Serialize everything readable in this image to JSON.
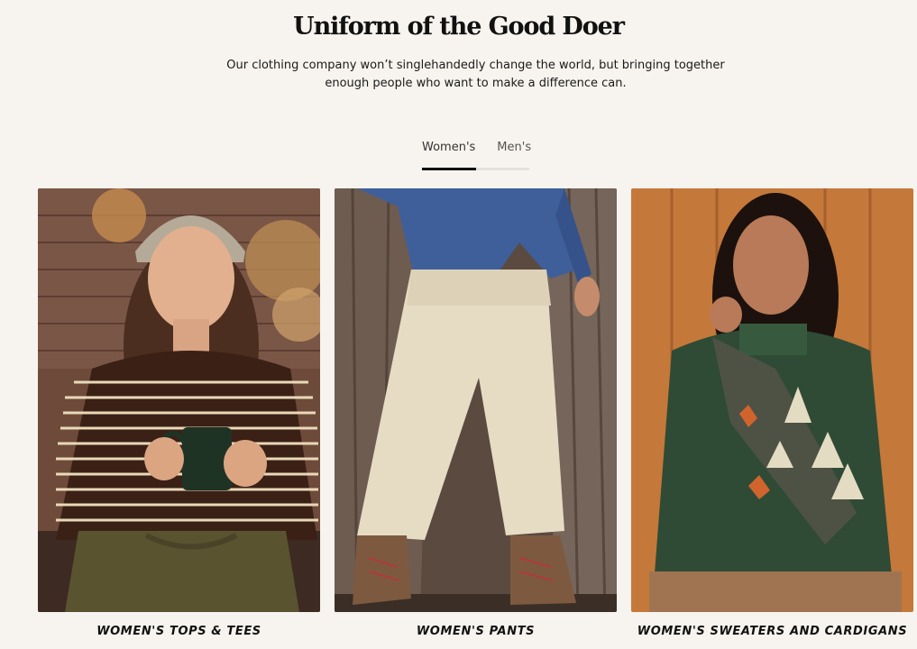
{
  "header": {
    "title": "Uniform of the Good Doer",
    "subtitle": "Our clothing company won’t singlehandedly change the world, but bringing together enough people who want to make a difference can."
  },
  "tabs": [
    {
      "label": "Women's",
      "active": true
    },
    {
      "label": "Men's",
      "active": false
    }
  ],
  "tab_progress": 0.5,
  "categories": [
    {
      "label": "WOMEN'S TOPS & TEES",
      "image": "woman-striped-top-holding-mug"
    },
    {
      "label": "WOMEN'S PANTS",
      "image": "woman-cream-pants-denim-jacket"
    },
    {
      "label": "WOMEN'S SWEATERS AND CARDIGANS",
      "image": "woman-green-tree-sweater"
    }
  ],
  "colors": {
    "background": "#f7f3ee",
    "text": "#111111",
    "tab_active_bar": "#111111",
    "tab_track": "#e4e0db"
  }
}
